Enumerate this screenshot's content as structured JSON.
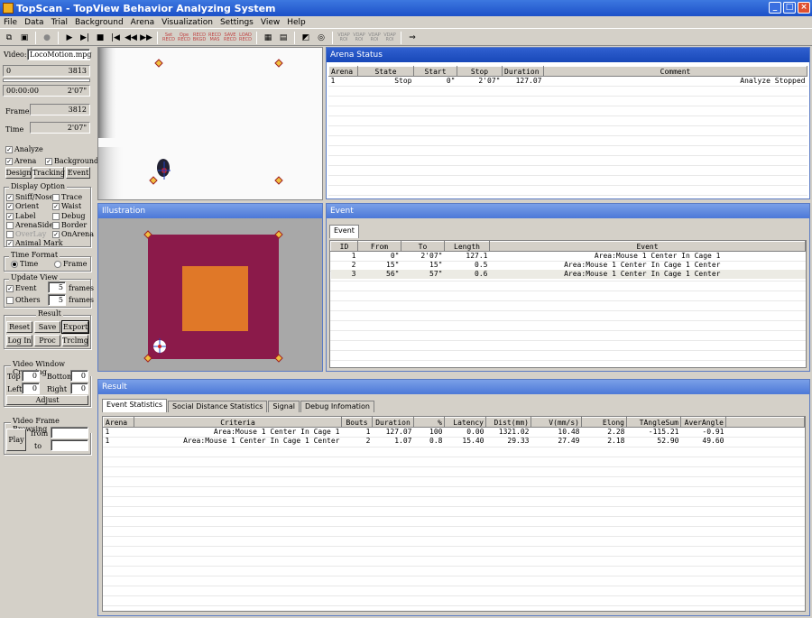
{
  "app": {
    "title": "TopScan - TopView Behavior Analyzing System"
  },
  "menu": [
    "File",
    "Data",
    "Trial",
    "Background",
    "Arena",
    "Visualization",
    "Settings",
    "View",
    "Help"
  ],
  "toolbar": {
    "labels": [
      "Set",
      "Ope",
      "RECD",
      "RECD",
      "SAVE",
      "LOAD"
    ],
    "labels2": [
      "RECD",
      "RECD",
      "BKGD",
      "MAS",
      "RECD",
      "RECD"
    ],
    "gray": [
      "VDAP",
      "VDAP",
      "VDAP",
      "VDAP"
    ],
    "gray2": [
      "ROI",
      "ROI",
      "ROI",
      "ROI"
    ]
  },
  "left": {
    "video_label": "Video:",
    "video_file": "LocoMotion.mpg",
    "range_start": "0",
    "range_end": "3813",
    "time_start": "00:00:00",
    "time_end": "2'07\"",
    "frame_label": "Frame",
    "frame_value": "3812",
    "time_label": "Time",
    "time_value": "2'07\"",
    "analyze": "Analyze",
    "arena": "Arena",
    "background": "Background",
    "design": "Design",
    "tracking": "Tracking",
    "event": "Event",
    "display_option": "Display Option",
    "opts": [
      "Sniff/Nose",
      "Trace",
      "Orient",
      "Waist",
      "Label",
      "Debug",
      "ArenaSide",
      "Border",
      "OverLay",
      "OnArena",
      "Animal Mark"
    ],
    "time_format": "Time Format",
    "tf_time": "Time",
    "tf_frame": "Frame",
    "update_view": "Update View",
    "uv_event": "Event",
    "uv_event_n": "5",
    "uv_others": "Others",
    "uv_others_n": "5",
    "frames": "frames",
    "result": "Result",
    "reset": "Reset",
    "save": "Save",
    "export": "Export",
    "login": "Log In",
    "proc": "Proc",
    "trclmg": "Trclmg",
    "cropping": "Video Window Cropping",
    "top": "Top",
    "bottom": "Bottom",
    "left_l": "Left",
    "right_l": "Right",
    "zero": "0",
    "adjust": "Adjust",
    "browsing": "Video Frame Browsing",
    "play": "Play",
    "from": "from",
    "to": "to"
  },
  "arena_status": {
    "title": "Arena Status",
    "headers": [
      "Arena",
      "State",
      "Start",
      "Stop",
      "Duration",
      "Comment"
    ],
    "rows": [
      [
        "1",
        "Stop",
        "0\"",
        "2'07\"",
        "127.07",
        "Analyze Stopped"
      ]
    ]
  },
  "illustration": {
    "title": "Illustration"
  },
  "event": {
    "title": "Event",
    "tab": "Event",
    "headers": [
      "ID",
      "From",
      "To",
      "Length",
      "Event"
    ],
    "rows": [
      [
        "1",
        "0\"",
        "2'07\"",
        "127.1",
        "Area:Mouse 1 Center In Cage 1"
      ],
      [
        "2",
        "15\"",
        "15\"",
        "0.5",
        "Area:Mouse 1 Center In Cage 1 Center"
      ],
      [
        "3",
        "56\"",
        "57\"",
        "0.6",
        "Area:Mouse 1 Center In Cage 1 Center"
      ]
    ]
  },
  "result": {
    "title": "Result",
    "tabs": [
      "Event Statistics",
      "Social Distance Statistics",
      "Signal",
      "Debug Infomation"
    ],
    "headers": [
      "Arena",
      "Criteria",
      "Bouts",
      "Duration",
      "%",
      "Latency",
      "Dist(mm)",
      "V(mm/s)",
      "Elong",
      "TAngleSum",
      "AverAngle"
    ],
    "rows": [
      [
        "1",
        "Area:Mouse 1 Center In Cage 1",
        "1",
        "127.07",
        "100",
        "0.00",
        "1321.02",
        "10.48",
        "2.28",
        "-115.21",
        "-0.91"
      ],
      [
        "1",
        "Area:Mouse 1 Center In Cage 1 Center",
        "2",
        "1.07",
        "0.8",
        "15.40",
        "29.33",
        "27.49",
        "2.18",
        "52.90",
        "49.60"
      ]
    ]
  },
  "colors": {
    "arena_outer": "#8b1a4a",
    "arena_inner": "#e07828",
    "illus_bg": "#a8a8a8"
  }
}
